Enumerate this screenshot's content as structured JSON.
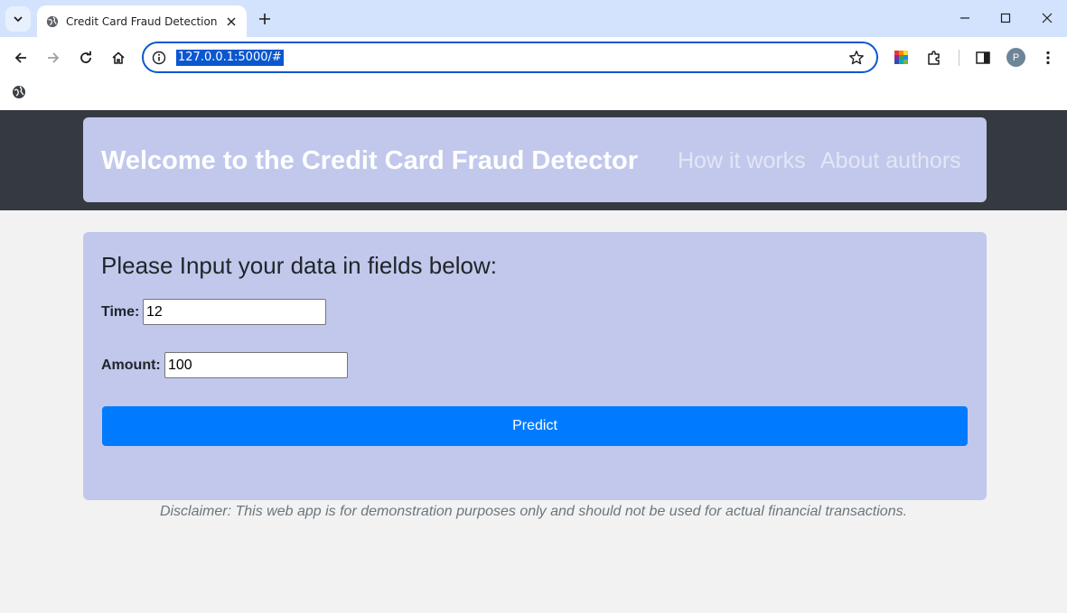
{
  "browser": {
    "tab_title": "Credit Card Fraud Detection",
    "url": "127.0.0.1:5000/#",
    "profile_initial": "P"
  },
  "header": {
    "brand": "Welcome to the Credit Card Fraud Detector",
    "nav": [
      "How it works",
      "About authors"
    ]
  },
  "form": {
    "title": "Please Input your data in fields below:",
    "time_label": "Time:",
    "time_value": "12",
    "amount_label": "Amount:",
    "amount_value": "100",
    "predict_label": "Predict"
  },
  "footer": {
    "disclaimer": "Disclaimer: This web app is for demonstration purposes only and should not be used for actual financial transactions."
  },
  "colors": {
    "header_bg": "#343a40",
    "card_bg": "#c1c8ec",
    "button_bg": "#007bff",
    "page_bg": "#f2f2f2"
  }
}
